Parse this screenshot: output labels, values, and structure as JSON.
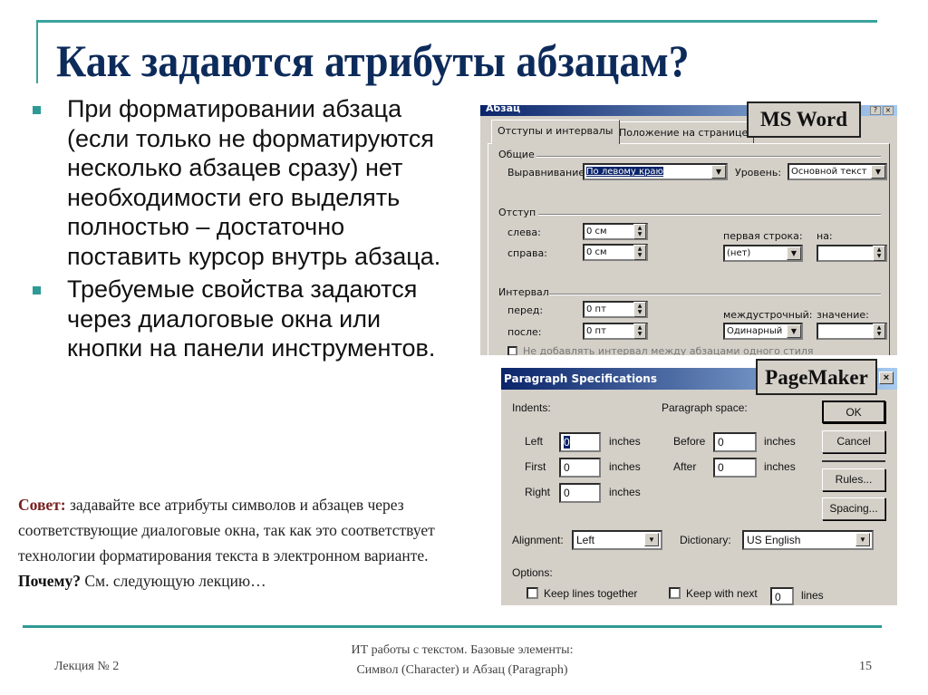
{
  "slide": {
    "title": "Как задаются атрибуты абзацам?",
    "bullets": [
      "При форматировании абзаца (если только не форматируются несколько абзацев сразу) нет необходимости его выделять полностью – достаточно поставить курсор внутрь абзаца.",
      "Требуемые свойства задаются через диалоговые окна или кнопки на панели инструментов."
    ],
    "advice": {
      "lead": "Совет:",
      "text": " задавайте все атрибуты символов и абзацев через соответствующие диалоговые окна, так как это соответствует технологии форматирования текста в электронном варианте.",
      "why_lead": "Почему?",
      "why_text": " См. следующую лекцию…"
    },
    "footer": {
      "left": "Лекция № 2",
      "middle_line1": "ИТ работы с текстом. Базовые элементы:",
      "middle_line2": "Символ (Character)  и Абзац (Paragraph)",
      "page_number": "15"
    },
    "colors": {
      "title": "#0d2b5a",
      "accent": "#2e9a95",
      "advice_lead": "#7a1f1f"
    }
  },
  "word_dialog": {
    "caption_label": "MS Word",
    "title": "Абзац",
    "tabs": [
      "Отступы и интервалы",
      "Положение на странице"
    ],
    "active_tab": 0,
    "group_general": "Общие",
    "alignment_label": "Выравнивание:",
    "alignment_value": "По левому краю",
    "level_label": "Уровень:",
    "level_value": "Основной текст",
    "group_indent": "Отступ",
    "left_label": "слева:",
    "left_value": "0 см",
    "right_label": "справа:",
    "right_value": "0 см",
    "first_line_label": "первая строка:",
    "first_line_value": "(нет)",
    "by_label": "на:",
    "by_value": "",
    "group_spacing": "Интервал",
    "before_label": "перед:",
    "before_value": "0 пт",
    "after_label": "после:",
    "after_value": "0 пт",
    "line_spacing_label": "междустрочный:",
    "line_spacing_value": "Одинарный",
    "at_label": "значение:",
    "at_value": "",
    "no_space_checkbox": "Не добавлять интервал между абзацами одного стиля"
  },
  "pm_dialog": {
    "caption_label": "PageMaker",
    "title": "Paragraph Specifications",
    "indents_label": "Indents:",
    "para_space_label": "Paragraph space:",
    "left_label": "Left",
    "left_value": "0",
    "first_label": "First",
    "first_value": "0",
    "right_label": "Right",
    "right_value": "0",
    "before_label": "Before",
    "before_value": "0",
    "after_label": "After",
    "after_value": "0",
    "unit": "inches",
    "ok": "OK",
    "cancel": "Cancel",
    "rules": "Rules...",
    "spacing": "Spacing...",
    "alignment_label": "Alignment:",
    "alignment_value": "Left",
    "dictionary_label": "Dictionary:",
    "dictionary_value": "US English",
    "options_label": "Options:",
    "keep_lines": "Keep lines together",
    "keep_next": "Keep with next",
    "keep_next_value": "0",
    "lines": "lines"
  }
}
